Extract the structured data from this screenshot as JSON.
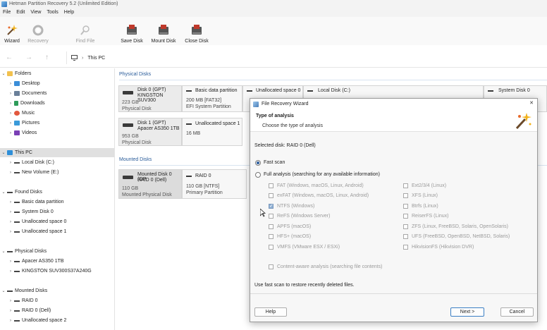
{
  "app": {
    "title": "Hetman Partition Recovery 5.2 (Unlimited Edition)"
  },
  "menu": [
    "File",
    "Edit",
    "View",
    "Tools",
    "Help"
  ],
  "toolbar": {
    "wizard": "Wizard",
    "recovery": "Recovery",
    "find_file": "Find File",
    "save_disk": "Save Disk",
    "mount_disk": "Mount Disk",
    "close_disk": "Close Disk"
  },
  "address": {
    "path": "This PC"
  },
  "tree": {
    "folders": "Folders",
    "folder_items": [
      "Desktop",
      "Documents",
      "Downloads",
      "Music",
      "Pictures",
      "Videos"
    ],
    "this_pc": "This PC",
    "pc_items": [
      "Local Disk (C:)",
      "New Volume (E:)"
    ],
    "found_disks": "Found Disks",
    "found_items": [
      "Basic data partition",
      "System Disk 0",
      "Unallocated space 0",
      "Unallocated space 1"
    ],
    "physical_disks": "Physical Disks",
    "physical_items": [
      "Apacer AS350 1TB",
      "KINGSTON SUV300S37A240G"
    ],
    "mounted_disks": "Mounted Disks",
    "mounted_items": [
      "RAID 0",
      "RAID 0 (Dell)",
      "Unallocated space 2"
    ]
  },
  "main": {
    "physical_title": "Physical Disks",
    "mounted_title": "Mounted Disks",
    "disk0": {
      "name": "Disk 0 (GPT)",
      "model": "KINGSTON SUV300",
      "size": "223 GB",
      "type": "Physical Disk"
    },
    "disk0_parts": {
      "p1_name": "Basic data partition",
      "p1_size": "200 MB [FAT32]",
      "p1_type": "EFI System Partition",
      "p2_name": "Unallocated space 0",
      "p3_name": "Local Disk (C:)",
      "p4_name": "System Disk 0"
    },
    "disk1": {
      "name": "Disk 1 (GPT)",
      "model": "Apacer AS350 1TB",
      "size": "953 GB",
      "type": "Physical Disk"
    },
    "disk1_parts": {
      "p1_name": "Unallocated space 1",
      "p1_size": "16 MB"
    },
    "mdisk0": {
      "name": "Mounted Disk 0 (GP",
      "model": "RAID 0 (Dell)",
      "size": "110 GB",
      "type": "Mounted Physical Disk"
    },
    "mdisk0_parts": {
      "p1_name": "RAID 0",
      "p1_size": "110 GB [NTFS]",
      "p1_type": "Primary Partition"
    }
  },
  "dialog": {
    "title": "File Recovery Wizard",
    "close": "✕",
    "heading": "Type of analysis",
    "subheading": "Choose the type of analysis",
    "selected_disk": "Selected disk: RAID 0 (Dell)",
    "fast_scan": "Fast scan",
    "full_analysis": "Full analysis (searching for any available information)",
    "fs_left": [
      "FAT (Windows, macOS, Linux, Android)",
      "exFAT (Windows, macOS, Linux, Android)",
      "NTFS (Windows)",
      "ReFS (Windows Server)",
      "APFS (macOS)",
      "HFS+ (macOS)",
      "VMFS (VMware ESX / ESXi)"
    ],
    "fs_right": [
      "Ext2/3/4 (Linux)",
      "XFS (Linux)",
      "Btrfs (Linux)",
      "ReiserFS (Linux)",
      "ZFS (Linux, FreeBSD, Solaris, OpenSolaris)",
      "UFS (FreeBSD, OpenBSD, NetBSD, Solaris)",
      "HikvisionFS (Hikvision DVR)"
    ],
    "content_aware": "Content-aware analysis (searching file contents)",
    "hint": "Use fast scan to restore recently deleted files.",
    "help": "Help",
    "next": "Next >",
    "cancel": "Cancel"
  }
}
